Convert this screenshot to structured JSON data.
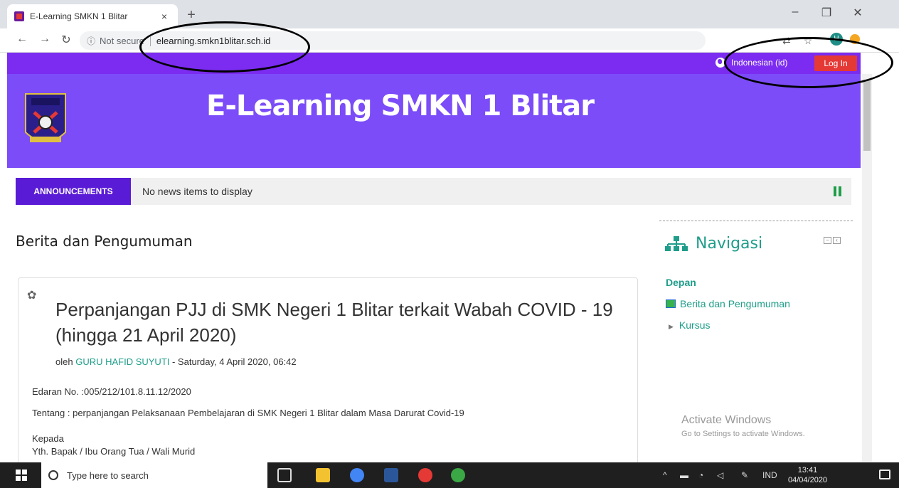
{
  "browser": {
    "tab_title": "E-Learning SMKN 1 Blitar",
    "tab_close": "×",
    "new_tab": "+",
    "security_label": "Not secure",
    "url": "elearning.smkn1blitar.sch.id",
    "profile_initial": "H"
  },
  "site": {
    "language": "Indonesian (id)",
    "login_label": "Log In",
    "site_name": "E-Learning SMKN 1 Blitar"
  },
  "announcements": {
    "label": "ANNOUNCEMENTS",
    "text": "No news items to display"
  },
  "main": {
    "section_title": "Berita dan Pengumuman",
    "post": {
      "title": "Perpanjangan PJJ di SMK Negeri 1 Blitar terkait Wabah COVID - 19 (hingga 21 April 2020)",
      "by_label": "oleh",
      "author": "GURU HAFID SUYUTI",
      "date": " - Saturday, 4 April 2020, 06:42",
      "line1": "Edaran No. :005/212/101.8.11.12/2020",
      "line2": "Tentang : perpanjangan Pelaksanaan Pembelajaran di SMK Negeri 1 Blitar dalam Masa Darurat Covid-19",
      "line3": "Kepada",
      "line4": "Yth. Bapak / Ibu Orang Tua / Wali Murid"
    }
  },
  "sidebar": {
    "title": "Navigasi",
    "items": [
      {
        "label": "Depan"
      },
      {
        "label": "Berita dan Pengumuman"
      },
      {
        "label": "Kursus"
      }
    ]
  },
  "watermark": {
    "line1": "Activate Windows",
    "line2": "Go to Settings to activate Windows."
  },
  "taskbar": {
    "search_placeholder": "Type here to search",
    "language": "IND",
    "time": "13:41",
    "date": "04/04/2020"
  },
  "colors": {
    "brand": "#7b4cf8",
    "topbar": "#7b2cf0",
    "accent": "#1e9e8a",
    "login": "#e53935"
  }
}
